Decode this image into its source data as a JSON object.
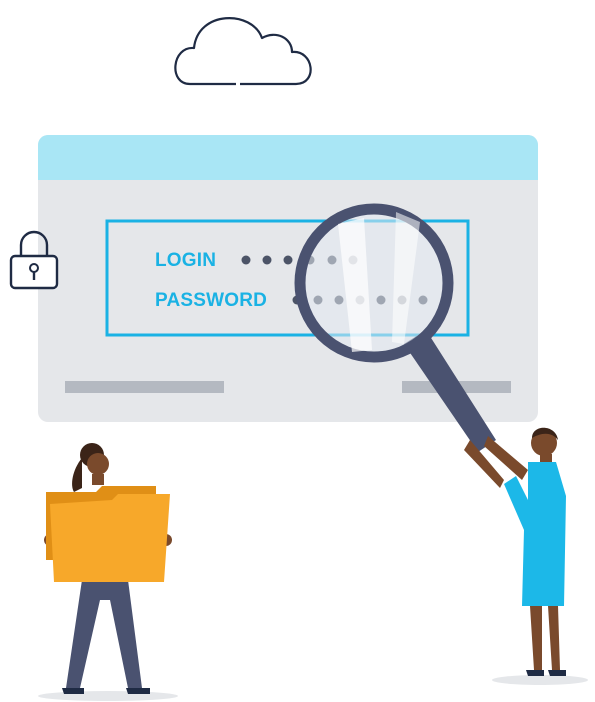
{
  "login_card": {
    "login_label": "LOGIN",
    "password_label": "PASSWORD"
  },
  "icons": [
    "cloud-icon",
    "padlock-icon",
    "magnifying-glass-icon",
    "folder-icon"
  ],
  "colors": {
    "accent": "#1ab2e4",
    "header_bar": "#a9e6f5",
    "card_body": "#e5e7ea",
    "placeholder_bar": "#b4b9c1",
    "outline": "#1f2b44",
    "folder": "#f7a82a",
    "dress": "#1cb8e8",
    "suit": "#4a5270"
  }
}
